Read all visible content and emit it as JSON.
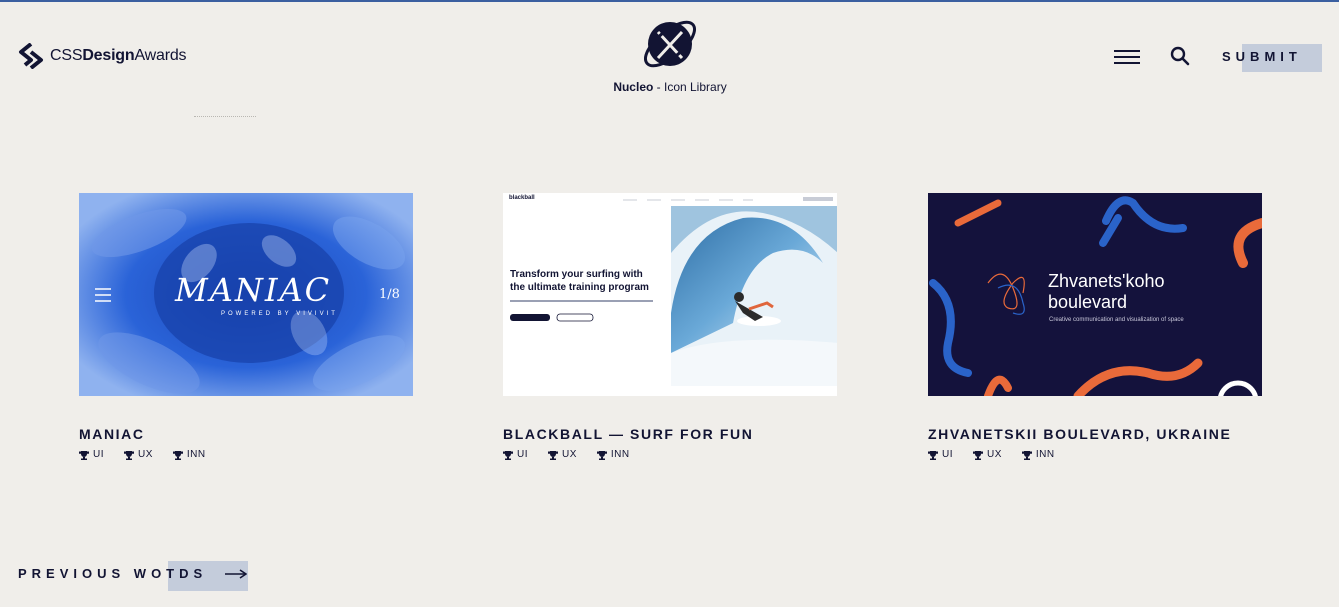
{
  "header": {
    "logo": {
      "pre": "CSS",
      "bold": "Design",
      "post": "Awards"
    },
    "sponsor": {
      "name": "Nucleo",
      "suffix": " - Icon Library"
    },
    "menu_icon": "hamburger-menu-icon",
    "search_icon": "search-icon",
    "submit_label": "SUBMIT"
  },
  "cards": [
    {
      "title": "MANIAC",
      "thumb": {
        "word": "MANIAC",
        "powered": "POWERED BY VIVIVIT",
        "counter": "1/8"
      },
      "awards": [
        "UI",
        "UX",
        "INN"
      ]
    },
    {
      "title": "BLACKBALL — SURF FOR FUN",
      "thumb": {
        "brand": "blackball",
        "headline_1": "Transform your surfing with",
        "headline_2": "the ultimate training program"
      },
      "awards": [
        "UI",
        "UX",
        "INN"
      ]
    },
    {
      "title": "ZHVANETSKII BOULEVARD, UKRAINE",
      "thumb": {
        "line_1": "Zhvanets'koho",
        "line_2": "boulevard",
        "tagline": "Creative communication and visualization of space"
      },
      "awards": [
        "UI",
        "UX",
        "INN"
      ]
    }
  ],
  "footer": {
    "prev_label": "PREVIOUS WOTDS",
    "arrow_icon": "arrow-right-icon"
  },
  "colors": {
    "background": "#f0eeea",
    "ink": "#121433",
    "accent_blue": "#2055c9",
    "orange": "#e96a3a"
  }
}
